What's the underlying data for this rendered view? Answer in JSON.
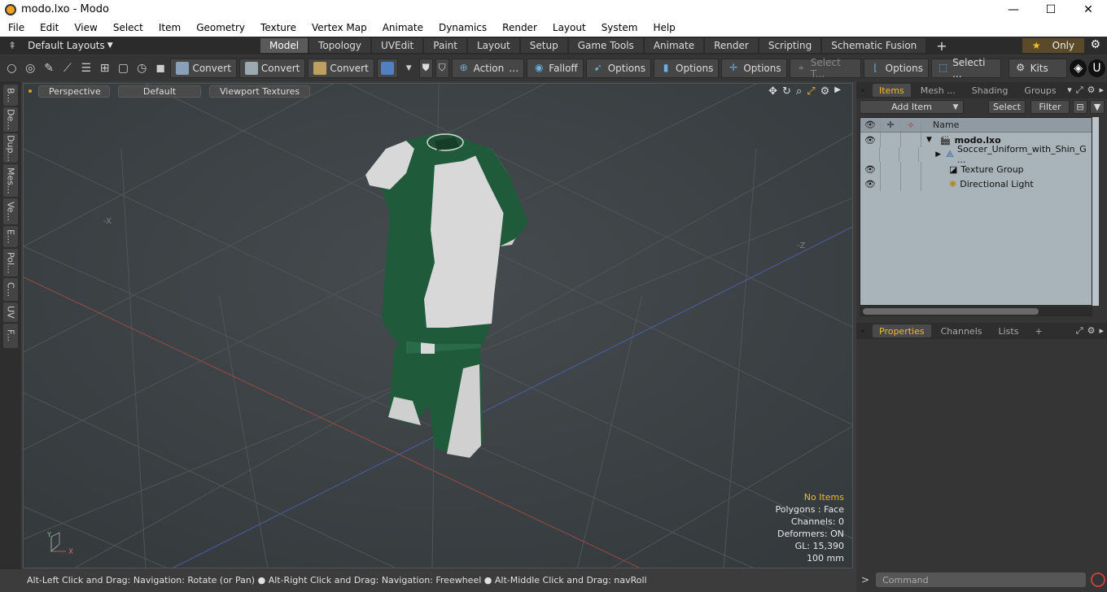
{
  "window": {
    "title": "modo.lxo - Modo",
    "min": "—",
    "max": "☐",
    "close": "✕"
  },
  "menu": [
    "File",
    "Edit",
    "View",
    "Select",
    "Item",
    "Geometry",
    "Texture",
    "Vertex Map",
    "Animate",
    "Dynamics",
    "Render",
    "Layout",
    "System",
    "Help"
  ],
  "layouts": {
    "label": "Default Layouts",
    "tabs": [
      "Model",
      "Topology",
      "UVEdit",
      "Paint",
      "Layout",
      "Setup",
      "Game Tools",
      "Animate",
      "Render",
      "Scripting",
      "Schematic Fusion"
    ],
    "active": "Model",
    "only": "Only"
  },
  "toolbar": {
    "convert1": "Convert",
    "convert2": "Convert",
    "convert3": "Convert",
    "action": "Action",
    "falloff": "Falloff",
    "options1": "Options",
    "options2": "Options",
    "options3": "Options",
    "select_t": "Select T...",
    "options4": "Options",
    "selecti": "Selecti ...",
    "kits": "Kits"
  },
  "left_tabs": [
    "B...",
    "De...",
    "Dup...",
    "Mes...",
    "Ve...",
    "E...",
    "Pol...",
    "C...",
    "UV",
    "F..."
  ],
  "viewport": {
    "perspective": "Perspective",
    "default": "Default",
    "textures": "Viewport Textures",
    "axis_x": "-X",
    "axis_z": "-Z"
  },
  "stats": {
    "no_items": "No Items",
    "polygons": "Polygons : Face",
    "channels": "Channels: 0",
    "deformers": "Deformers: ON",
    "gl": "GL: 15,390",
    "scale": "100 mm"
  },
  "status": "Alt-Left Click and Drag: Navigation: Rotate (or Pan) ● Alt-Right Click and Drag: Navigation: Freewheel ● Alt-Middle Click and Drag: navRoll",
  "items_panel": {
    "tabs": [
      "Items",
      "Mesh ...",
      "Shading",
      "Groups"
    ],
    "add_item": "Add Item",
    "select": "Select",
    "filter": "Filter",
    "name_col": "Name",
    "rows": [
      {
        "name": "modo.lxo",
        "eye": true
      },
      {
        "name": "Soccer_Uniform_with_Shin_G ...",
        "eye": false
      },
      {
        "name": "Texture Group",
        "eye": true
      },
      {
        "name": "Directional Light",
        "eye": true
      }
    ]
  },
  "props_panel": {
    "tabs": [
      "Properties",
      "Channels",
      "Lists"
    ]
  },
  "command": {
    "placeholder": "Command"
  },
  "colors": {
    "accent": "#f0b830",
    "jersey_green": "#1f5a3a",
    "jersey_white": "#d8d8d8"
  }
}
